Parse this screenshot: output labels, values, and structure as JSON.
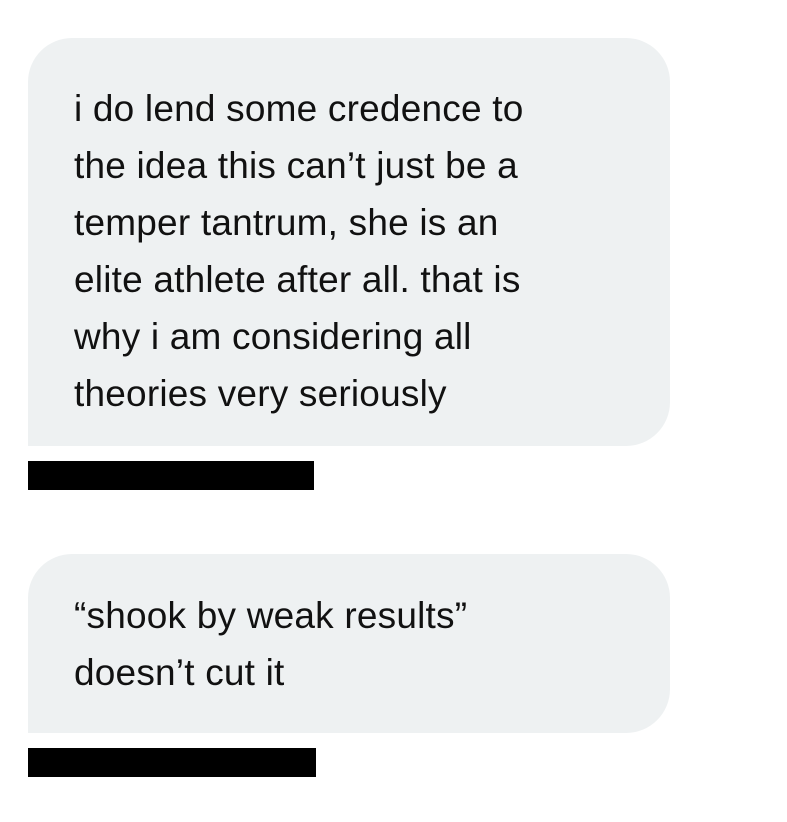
{
  "messages": [
    {
      "lines": [
        "i do lend some credence to",
        "the idea this can’t just be a",
        "temper tantrum, she is an",
        "elite athlete after all. that is",
        "why i am considering all",
        "theories very seriously"
      ]
    },
    {
      "lines": [
        "“shook by weak results”",
        "doesn’t cut it"
      ]
    }
  ],
  "colors": {
    "bubble_background": "#eef1f2",
    "text": "#111111",
    "redaction": "#000000",
    "page_background": "#ffffff"
  }
}
